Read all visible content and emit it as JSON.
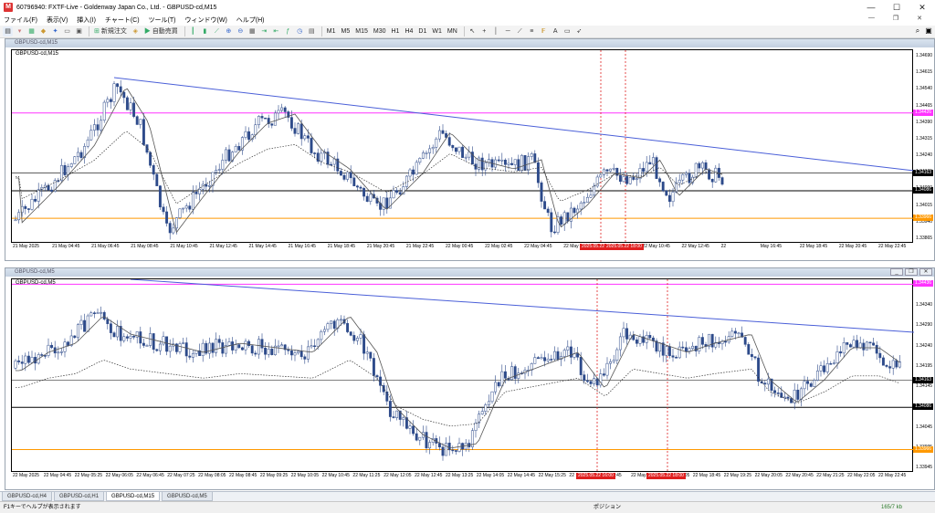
{
  "window": {
    "title": "60796940: FXTF-Live - Goldenway Japan Co., Ltd. - GBPUSD-cd,M15",
    "app_icon": "mt4-icon",
    "minimize": "—",
    "maximize": "☐",
    "close": "✕"
  },
  "menu": {
    "items": [
      "ファイル(F)",
      "表示(V)",
      "挿入(I)",
      "チャート(C)",
      "ツール(T)",
      "ウィンドウ(W)",
      "ヘルプ(H)"
    ],
    "mdi_minimize": "—",
    "mdi_restore": "❐",
    "mdi_close": "✕"
  },
  "toolbar": {
    "new_order": "新規注文",
    "auto_trading": "自動売買",
    "timeframes": [
      "M1",
      "M5",
      "M15",
      "M30",
      "H1",
      "H4",
      "D1",
      "W1",
      "MN"
    ]
  },
  "charts": [
    {
      "window_title": "GBPUSD-cd,M15",
      "label": "GBPUSD-cd,M15",
      "price_labels": [
        "1.34690",
        "1.34615",
        "1.34540",
        "1.34465",
        "1.34390",
        "1.34315",
        "1.34240",
        "1.34165",
        "1.34090",
        "1.34015",
        "1.33940",
        "1.33865"
      ],
      "tags": [
        {
          "text": "1.34426",
          "color": "#ff33ff",
          "price": 1.34426
        },
        {
          "text": "1.34163",
          "color": "#000000",
          "price": 1.34163
        },
        {
          "text": "1.34086",
          "color": "#000000",
          "price": 1.34086
        },
        {
          "text": "1.33966",
          "color": "#ff9900",
          "price": 1.33966
        }
      ],
      "time_labels": [
        "21 May 2025",
        "21 May 04:45",
        "21 May 06:45",
        "21 May 08:45",
        "21 May 10:45",
        "21 May 12:45",
        "21 May 14:45",
        "21 May 16:45",
        "21 May 18:45",
        "21 May 20:45",
        "21 May 22:45",
        "22 May 00:45",
        "22 May 02:45",
        "22 May 04:45",
        "22 May 06:45",
        "22 May 08:45",
        "22 May 10:45",
        "22 May 12:45",
        "22",
        "May 16:45",
        "22 May 18:45",
        "22 May 20:45",
        "22 May 22:45"
      ],
      "vtags": [
        "2025.05.22 16:00",
        "2025.05.22 18:00"
      ]
    },
    {
      "window_title": "GBPUSD-cd,M5",
      "label": "GBPUSD-cd,M5",
      "price_labels": [
        "1.34390",
        "1.34340",
        "1.34290",
        "1.34240",
        "1.34195",
        "1.34145",
        "1.34095",
        "1.34045",
        "1.33995",
        "1.33945"
      ],
      "tags": [
        {
          "text": "1.34436",
          "color": "#ff33ff",
          "price": 1.34436
        },
        {
          "text": "1.34163",
          "color": "#000000",
          "price": 1.34163
        },
        {
          "text": "1.34086",
          "color": "#000000",
          "price": 1.34086
        },
        {
          "text": "1.33966",
          "color": "#ff9900",
          "price": 1.33966
        }
      ],
      "time_labels": [
        "22 May 2025",
        "22 May 04:45",
        "22 May 05:25",
        "22 May 06:05",
        "22 May 06:45",
        "22 May 07:25",
        "22 May 08:05",
        "22 May 08:45",
        "22 May 09:25",
        "22 May 10:05",
        "22 May 10:45",
        "22 May 11:25",
        "22 May 12:05",
        "22 May 12:45",
        "22 May 13:25",
        "22 May 14:05",
        "22 May 14:45",
        "22 May 15:25",
        "22",
        "May 16:45",
        "22 May 17:25",
        "22 May 18:05",
        "22 May 18:45",
        "22 May 19:25",
        "22 May 20:05",
        "22 May 20:45",
        "22 May 21:25",
        "22 May 22:05",
        "22 May 22:45"
      ],
      "vtags": [
        "2025.05.22 16:00",
        "2025.05.22 18:00"
      ]
    }
  ],
  "tabs": [
    "GBPUSD-cd,H4",
    "GBPUSD-cd,H1",
    "GBPUSD-cd,M15",
    "GBPUSD-cd,M5"
  ],
  "active_tab": 2,
  "status": {
    "help": "F1キーでヘルプが表示されます",
    "profile": "ポジション",
    "conn": "165/7 kb"
  }
}
